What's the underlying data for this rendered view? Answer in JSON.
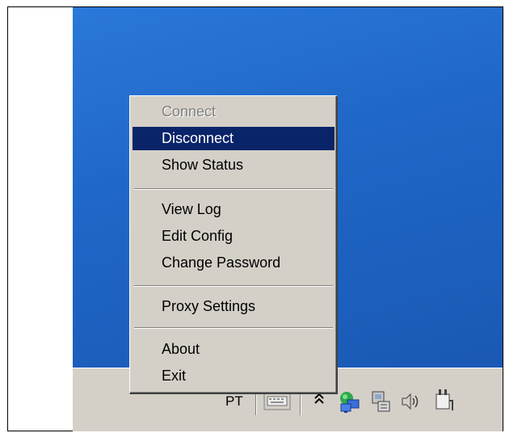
{
  "menu": {
    "items": [
      {
        "label": "Connect",
        "state": "disabled"
      },
      {
        "label": "Disconnect",
        "state": "selected"
      },
      {
        "label": "Show Status",
        "state": "normal"
      },
      {
        "label": "View Log",
        "state": "normal"
      },
      {
        "label": "Edit Config",
        "state": "normal"
      },
      {
        "label": "Change Password",
        "state": "normal"
      },
      {
        "label": "Proxy Settings",
        "state": "normal"
      },
      {
        "label": "About",
        "state": "normal"
      },
      {
        "label": "Exit",
        "state": "normal"
      }
    ]
  },
  "taskbar": {
    "language_indicator": "PT",
    "tray_icons": [
      "keyboard-icon",
      "show-hidden-icons-chevron",
      "network-connection-icon",
      "network-adapter-icon",
      "volume-icon",
      "power-plug-icon"
    ]
  },
  "colors": {
    "desktop": "#1f66c6",
    "menu_background": "#d4d0c8",
    "selection": "#0a246a",
    "disabled_text": "#808080"
  }
}
